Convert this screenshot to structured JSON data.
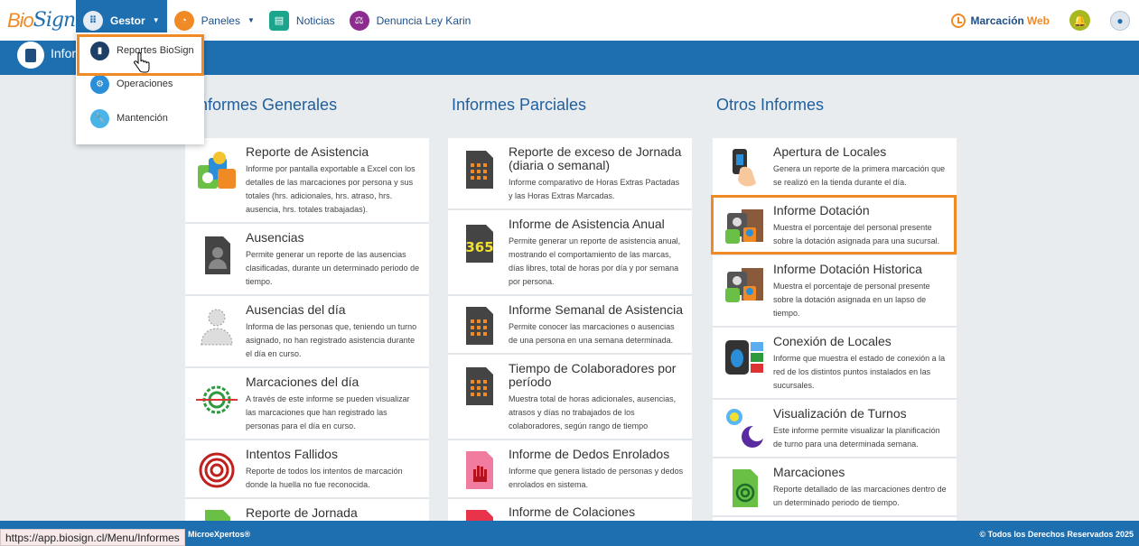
{
  "nav": {
    "logo": "Bio",
    "logo_script": "Sign",
    "gestor": "Gestor",
    "paneles": "Paneles",
    "noticias": "Noticias",
    "denuncia": "Denuncia Ley Karin",
    "marcacion": "Marcación",
    "marcacion_web": "Web"
  },
  "header": {
    "title": "Informes"
  },
  "dropdown": {
    "items": [
      {
        "label": "Reportes BioSign"
      },
      {
        "label": "Operaciones"
      },
      {
        "label": "Mantención"
      }
    ]
  },
  "columns": [
    {
      "title": "Informes Generales",
      "cards": [
        {
          "title": "Reporte de Asistencia",
          "desc": "Informe por pantalla exportable a Excel con los detalles de las marcaciones por persona y sus totales (hrs. adicionales, hrs. atraso, hrs. ausencia, hrs. totales trabajadas)."
        },
        {
          "title": "Ausencias",
          "desc": "Permite generar un reporte de las ausencias clasificadas, durante un determinado periodo de tiempo."
        },
        {
          "title": "Ausencias del día",
          "desc": "Informa de las personas que, teniendo un turno asignado, no han registrado asistencia durante el día en curso."
        },
        {
          "title": "Marcaciones del día",
          "desc": "A través de este informe se pueden visualizar las marcaciones que han registrado las personas para el día en curso."
        },
        {
          "title": "Intentos Fallidos",
          "desc": "Reporte de todos los intentos de marcación donde la huella no fue reconocida."
        },
        {
          "title": "Reporte de Jornada",
          "desc": ""
        }
      ]
    },
    {
      "title": "Informes Parciales",
      "cards": [
        {
          "title": "Reporte de exceso de Jornada (diaria o semanal)",
          "desc": "Informe comparativo de Horas Extras Pactadas y las Horas Extras Marcadas."
        },
        {
          "title": "Informe de Asistencia Anual",
          "desc": "Permite generar un reporte de asistencia anual, mostrando el comportamiento de las marcas, días libres, total de horas por día y por semana por persona."
        },
        {
          "title": "Informe Semanal de Asistencia",
          "desc": "Permite conocer las marcaciones o ausencias de una persona en una semana determinada."
        },
        {
          "title": "Tiempo de Colaboradores por período",
          "desc": "Muestra total de horas adicionales, ausencias, atrasos y días no trabajados de los colaboradores, según rango de tiempo"
        },
        {
          "title": "Informe de Dedos Enrolados",
          "desc": "Informe que genera listado de personas y dedos enrolados en sistema."
        },
        {
          "title": "Informe de Colaciones",
          "desc": ""
        }
      ]
    },
    {
      "title": "Otros Informes",
      "cards": [
        {
          "title": "Apertura de Locales",
          "desc": "Genera un reporte de la primera marcación que se realizó en la tienda durante el día."
        },
        {
          "title": "Informe Dotación",
          "desc": "Muestra el porcentaje del personal presente sobre la dotación asignada para una sucursal."
        },
        {
          "title": "Informe Dotación Historica",
          "desc": "Muestra el porcentaje de personal presente sobre la dotación asignada en un lapso de tiempo."
        },
        {
          "title": "Conexión de Locales",
          "desc": "Informe que muestra el estado de conexión a la red de los distintos puntos instalados en las sucursales."
        },
        {
          "title": "Visualización de Turnos",
          "desc": "Este informe permite visualizar la planificación de turno para una determinada semana."
        },
        {
          "title": "Marcaciones",
          "desc": "Reporte detallado de las marcaciones dentro de un determinado periodo de tiempo."
        }
      ]
    }
  ],
  "footer": {
    "left": "MicroeXpertos®",
    "right": "© Todos los Derechos Reservados 2025"
  },
  "status_url": "https://app.biosign.cl/Menu/Informes"
}
